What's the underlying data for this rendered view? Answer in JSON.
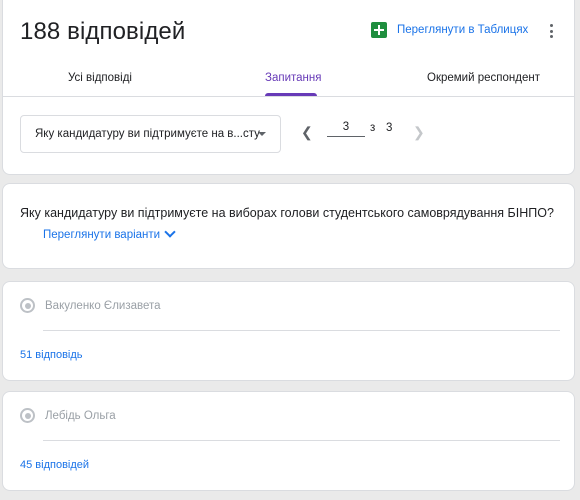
{
  "header": {
    "responses_title": "188 відповідей",
    "sheets_link": "Переглянути в Таблицях"
  },
  "tabs": [
    {
      "label": "Усі відповіді",
      "active": false
    },
    {
      "label": "Запитання",
      "active": true
    },
    {
      "label": "Окремий респондент",
      "active": false
    }
  ],
  "question_nav": {
    "selected_question": "Яку кандидатуру ви підтримуєте на в...сту",
    "current_page": "3",
    "of_label": "з",
    "total_pages": "3"
  },
  "question": {
    "text": "Яку кандидатуру ви підтримуєте на виборах голови студентського самоврядування БІНПО?",
    "view_options": "Переглянути варіанти"
  },
  "answers": [
    {
      "label": "Вакуленко Єлизавета",
      "count": "51 відповідь"
    },
    {
      "label": "Лебідь Ольга",
      "count": "45 відповідей"
    }
  ],
  "colors": {
    "accent": "#673ab7",
    "link": "#1a73e8",
    "sheets_green": "#1e8e3e",
    "background": "#eaeaea"
  },
  "icons": [
    "sheets-icon",
    "more-vert-icon",
    "chevron-left-icon",
    "chevron-right-icon",
    "dropdown-arrow-icon",
    "chevron-down-icon",
    "radio-icon"
  ]
}
